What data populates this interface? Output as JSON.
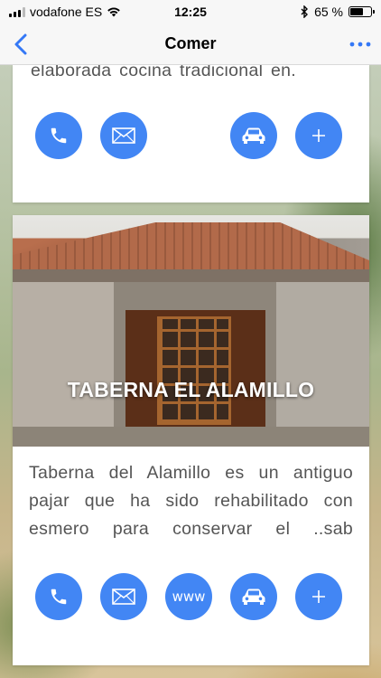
{
  "status_bar": {
    "carrier": "vodafone ES",
    "time": "12:25",
    "battery": "65 %",
    "battery_level": 0.65
  },
  "nav": {
    "title": "Comer"
  },
  "cards": [
    {
      "description": "elaborada cocina tradicional en.",
      "actions": [
        {
          "icon": "phone-icon"
        },
        {
          "icon": "mail-icon"
        },
        {
          "icon": "car-icon"
        },
        {
          "icon": "plus-icon"
        }
      ]
    },
    {
      "title": "TABERNA EL ALAMILLO",
      "description": "Taberna del Alamillo es un antiguo pajar que ha sido rehabilitado con esmero para conservar el ..sab",
      "actions": [
        {
          "icon": "phone-icon"
        },
        {
          "icon": "mail-icon"
        },
        {
          "label": "www",
          "icon": "web-icon"
        },
        {
          "icon": "car-icon"
        },
        {
          "icon": "plus-icon"
        }
      ]
    }
  ],
  "colors": {
    "accent": "#4286f4",
    "nav_tint": "#3478f6"
  }
}
